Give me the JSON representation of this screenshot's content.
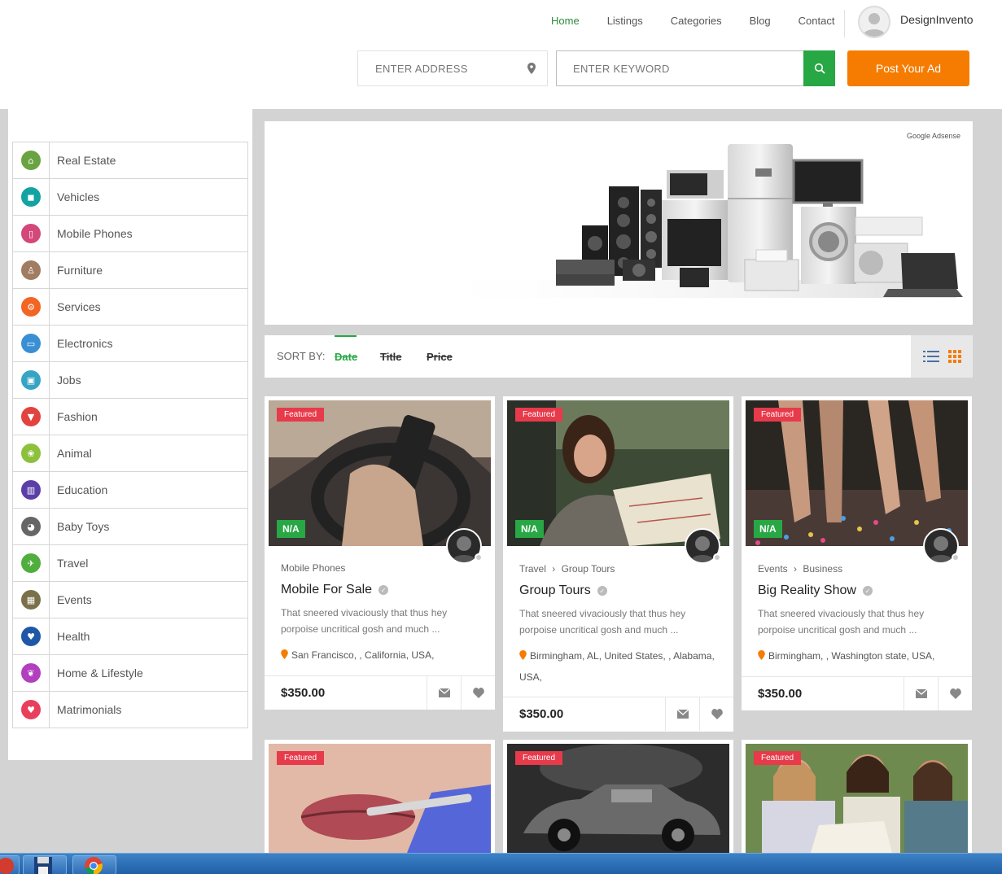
{
  "header": {
    "nav": [
      "Home",
      "Listings",
      "Categories",
      "Blog",
      "Contact"
    ],
    "user_name": "DesignInvento",
    "address_placeholder": "ENTER ADDRESS",
    "keyword_placeholder": "ENTER KEYWORD",
    "post_ad_label": "Post Your Ad"
  },
  "sidebar": {
    "categories": [
      {
        "label": "Real Estate",
        "icon": "home-icon",
        "color": "#6aa342"
      },
      {
        "label": "Vehicles",
        "icon": "car-icon",
        "color": "#13a3a3"
      },
      {
        "label": "Mobile Phones",
        "icon": "mobile-icon",
        "color": "#d4477b"
      },
      {
        "label": "Furniture",
        "icon": "chair-icon",
        "color": "#a07c62"
      },
      {
        "label": "Services",
        "icon": "gear-icon",
        "color": "#f26522"
      },
      {
        "label": "Electronics",
        "icon": "monitor-icon",
        "color": "#3a8fd4"
      },
      {
        "label": "Jobs",
        "icon": "briefcase-icon",
        "color": "#36a4c4"
      },
      {
        "label": "Fashion",
        "icon": "shirt-icon",
        "color": "#e2433f"
      },
      {
        "label": "Animal",
        "icon": "paw-icon",
        "color": "#8cc03d"
      },
      {
        "label": "Education",
        "icon": "book-icon",
        "color": "#5b3ea7"
      },
      {
        "label": "Baby Toys",
        "icon": "toy-icon",
        "color": "#666666"
      },
      {
        "label": "Travel",
        "icon": "plane-icon",
        "color": "#4fae3d"
      },
      {
        "label": "Events",
        "icon": "calendar-icon",
        "color": "#7a7049"
      },
      {
        "label": "Health",
        "icon": "heart-pulse-icon",
        "color": "#1f57a8"
      },
      {
        "label": "Home & Lifestyle",
        "icon": "leaf-icon",
        "color": "#b23fbe"
      },
      {
        "label": "Matrimonials",
        "icon": "heart-icon",
        "color": "#e8405c"
      }
    ]
  },
  "ad": {
    "label": "Google Adsense"
  },
  "sort": {
    "label": "SORT BY:",
    "options": [
      "Date",
      "Title",
      "Price"
    ],
    "active": "Date"
  },
  "listings": [
    {
      "featured": "Featured",
      "badge": "N/A",
      "category": "Mobile Phones",
      "title": "Mobile For Sale",
      "description": "That sneered vivaciously that thus hey porpoise uncritical gosh and much ...",
      "location": "San Francisco, , California, USA,",
      "price": "$350.00"
    },
    {
      "featured": "Featured",
      "badge": "N/A",
      "category": "Travel",
      "subcategory": "Group Tours",
      "title": "Group Tours",
      "description": "That sneered vivaciously that thus hey porpoise uncritical gosh and much ...",
      "location": "Birmingham, AL, United States, , Alabama, USA,",
      "price": "$350.00"
    },
    {
      "featured": "Featured",
      "badge": "N/A",
      "category": "Events",
      "subcategory": "Business",
      "title": "Big Reality Show",
      "description": "That sneered vivaciously that thus hey porpoise uncritical gosh and much ...",
      "location": "Birmingham, , Washington state, USA,",
      "price": "$350.00"
    },
    {
      "featured": "Featured"
    },
    {
      "featured": "Featured"
    },
    {
      "featured": "Featured"
    }
  ],
  "colors": {
    "accent_green": "#28a745",
    "accent_orange": "#f57c00",
    "featured_red": "#e73a4a"
  }
}
